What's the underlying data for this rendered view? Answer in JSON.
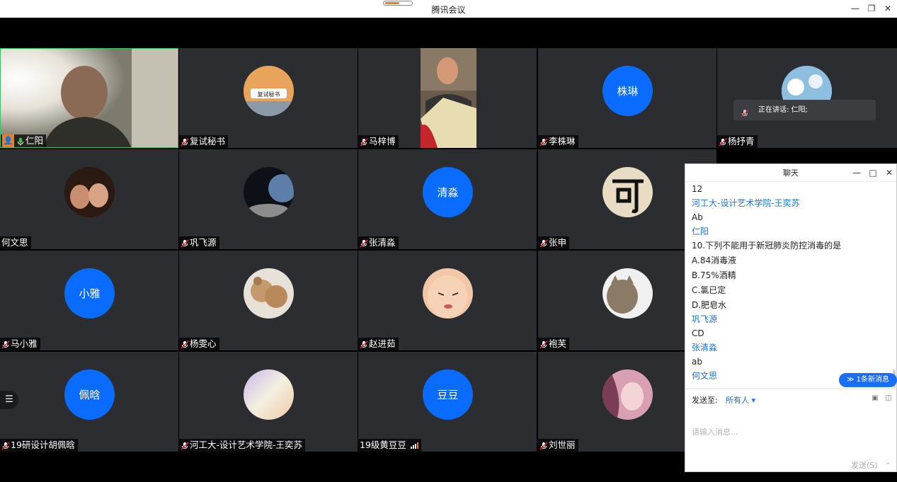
{
  "app": {
    "title": "腾讯会议"
  },
  "participants": [
    {
      "name": "仁阳",
      "video": "camera"
    },
    {
      "name": "复试秘书",
      "avatar": "image"
    },
    {
      "name": "马梓博",
      "video": "camera"
    },
    {
      "name": "李株琳",
      "avatar_text": "株琳"
    },
    {
      "name": "杨抒青",
      "avatar": "image"
    },
    {
      "name": "何文思",
      "avatar": "image"
    },
    {
      "name": "巩飞源",
      "avatar": "image"
    },
    {
      "name": "张清淼",
      "avatar_text": "清淼"
    },
    {
      "name": "张申",
      "avatar": "image"
    },
    {
      "name": "马小雅",
      "avatar_text": "小雅"
    },
    {
      "name": "杨雯心",
      "avatar": "image"
    },
    {
      "name": "赵进茹",
      "avatar": "image"
    },
    {
      "name": "袍芙",
      "avatar": "image"
    },
    {
      "name": "19研设计胡佩晗",
      "avatar_text": "佩晗"
    },
    {
      "name": "河工大-设计艺术学院-王奕苏",
      "avatar": "image"
    },
    {
      "name": "19级黄豆豆",
      "avatar_text": "豆豆"
    },
    {
      "name": "刘世丽",
      "avatar": "image"
    }
  ],
  "speaking": {
    "label": "正在讲话: 仁阳;"
  },
  "chat": {
    "title": "聊天",
    "messages": [
      {
        "type": "text",
        "text": "12"
      },
      {
        "type": "sender",
        "text": "河工大-设计艺术学院-王奕苏"
      },
      {
        "type": "text",
        "text": "Ab"
      },
      {
        "type": "sender",
        "text": "仁阳"
      },
      {
        "type": "text",
        "text": "10.下列不能用于新冠肺炎防控消毒的是"
      },
      {
        "type": "text",
        "text": "A.84消毒液"
      },
      {
        "type": "text",
        "text": "B.75%酒精"
      },
      {
        "type": "text",
        "text": "C.氯已定"
      },
      {
        "type": "text",
        "text": "D.肥皂水"
      },
      {
        "type": "sender",
        "text": "巩飞源"
      },
      {
        "type": "text",
        "text": "CD"
      },
      {
        "type": "sender",
        "text": "张清淼"
      },
      {
        "type": "text",
        "text": "ab"
      },
      {
        "type": "sender",
        "text": "何文思"
      }
    ],
    "new_message_badge": "1条新消息",
    "send_to_label": "发送至:",
    "send_to_value": "所有人",
    "input_placeholder": "请输入消息...",
    "send_label": "发送(S)"
  },
  "colors": {
    "accent": "#0a6bff",
    "chat_sender": "#1a73e8",
    "tile_bg": "#2b2d30"
  }
}
